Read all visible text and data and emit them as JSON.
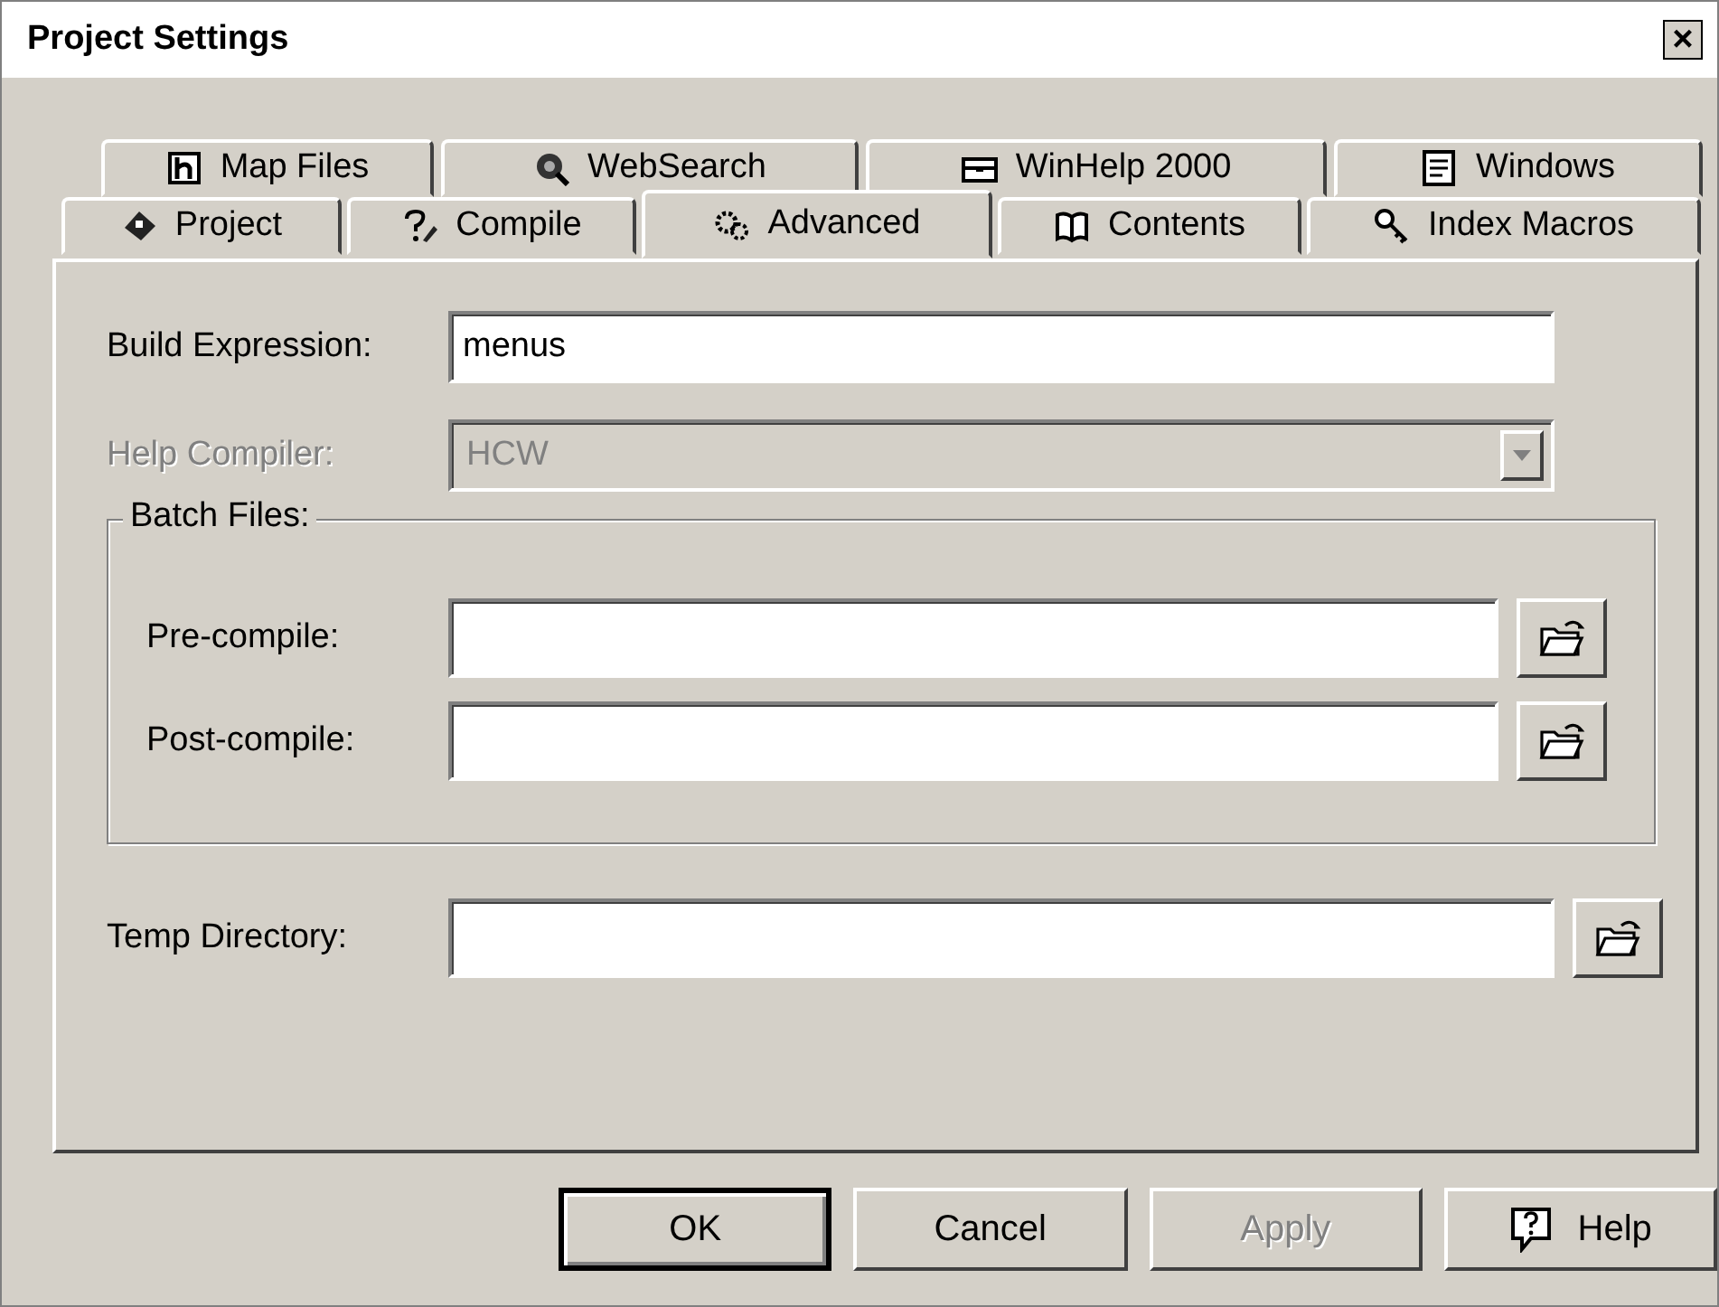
{
  "window": {
    "title": "Project Settings",
    "close": "×"
  },
  "tab_rows": [
    [
      {
        "label": "Map Files",
        "selected": false
      },
      {
        "label": "WebSearch",
        "selected": false
      },
      {
        "label": "WinHelp 2000",
        "selected": false
      },
      {
        "label": "Windows",
        "selected": false
      }
    ],
    [
      {
        "label": "Project",
        "selected": false
      },
      {
        "label": "Compile",
        "selected": false
      },
      {
        "label": "Advanced",
        "selected": true
      },
      {
        "label": "Contents",
        "selected": false
      },
      {
        "label": "Index Macros",
        "selected": false
      }
    ]
  ],
  "build_expression": {
    "label": "Build Expression:",
    "value": "menus"
  },
  "help_compiler": {
    "label": "Help Compiler:",
    "value": "HCW",
    "disabled": true
  },
  "batch_files": {
    "title": "Batch Files:",
    "fields": [
      {
        "label": "Pre-compile:"
      },
      {
        "label": "Post-compile:"
      }
    ]
  },
  "temp_directory": {
    "label": "Temp Directory:"
  },
  "buttons": [
    {
      "label": "OK",
      "kind": "default",
      "disabled": false
    },
    {
      "label": "Cancel",
      "kind": "plain",
      "disabled": false
    },
    {
      "label": "Apply",
      "kind": "plain",
      "disabled": true
    },
    {
      "label": "Help",
      "kind": "help",
      "disabled": false
    }
  ]
}
